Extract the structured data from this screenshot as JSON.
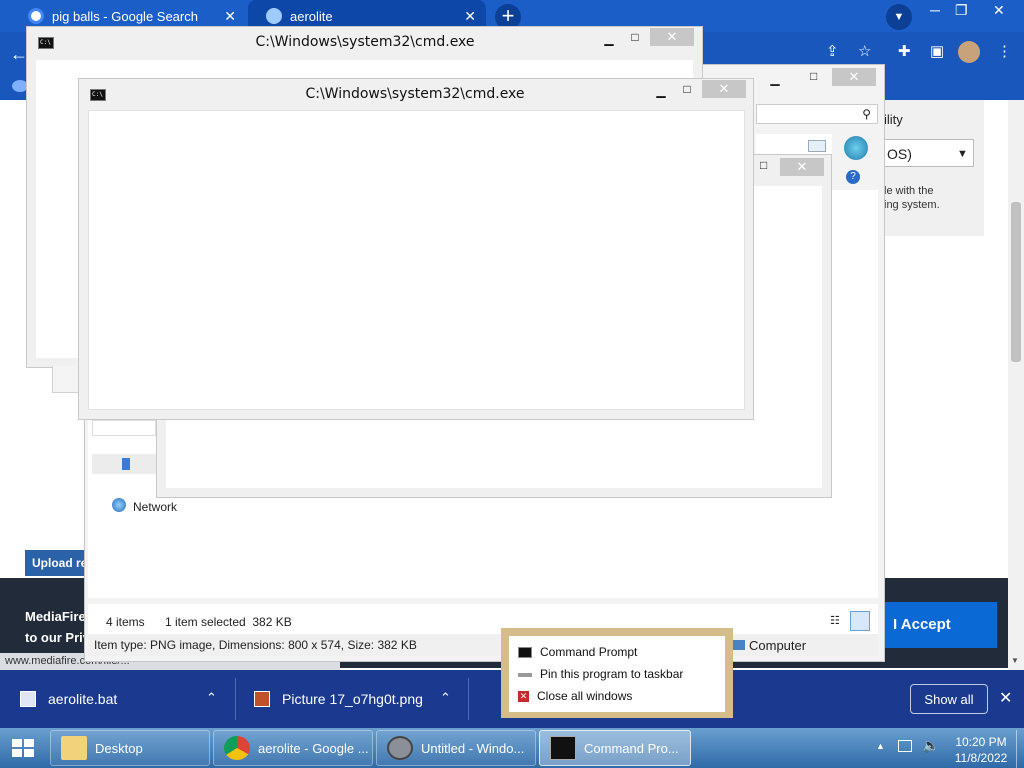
{
  "browser": {
    "tabs": [
      {
        "label": "pig balls - Google Search",
        "close": "✕"
      },
      {
        "label": "aerolite",
        "close": "✕"
      }
    ],
    "new_tab": "+"
  },
  "mediafire": {
    "panel_text": "ility",
    "select_value": "OS)",
    "description_line1": "le with the",
    "description_line2": "ing system.",
    "upload_label": "Upload reg",
    "cookie_line1": "MediaFire",
    "cookie_line2": "to our Priv",
    "accept_label": "I Accept",
    "status_url": "www.mediafire.com/file/..."
  },
  "downloads": {
    "items": [
      {
        "name": "aerolite.bat"
      },
      {
        "name": "Picture 17_o7hg0t.png"
      }
    ],
    "show_all": "Show all",
    "close": "✕"
  },
  "explorer": {
    "network_label": "Network",
    "items_count": "4 items",
    "selected": "1 item selected  382 KB",
    "details": "Item type: PNG image, Dimensions: 800 x 574, Size: 382 KB",
    "computer_label": "Computer"
  },
  "cmd_windows": [
    {
      "title": "C:\\Windows\\system32\\cmd.exe"
    },
    {
      "title": "C:\\Windows\\system32\\cmd.exe"
    }
  ],
  "caption_buttons": {
    "minimize": "▁",
    "maximize": "□",
    "close": "✕"
  },
  "jumplist": {
    "items": [
      {
        "label": "Command Prompt"
      },
      {
        "label": "Pin this program to taskbar"
      },
      {
        "label": "Close all windows"
      }
    ]
  },
  "taskbar": {
    "buttons": [
      {
        "label": "Desktop"
      },
      {
        "label": "aerolite - Google ..."
      },
      {
        "label": "Untitled - Windo..."
      },
      {
        "label": "Command Pro..."
      }
    ],
    "time": "10:20 PM",
    "date": "11/8/2022"
  },
  "colors": {
    "chrome_blue": "#1b5ec7",
    "taskbar_blue": "#3b76b5",
    "accept_blue": "#0b69d6",
    "cookie_bar": "#222b3a"
  }
}
